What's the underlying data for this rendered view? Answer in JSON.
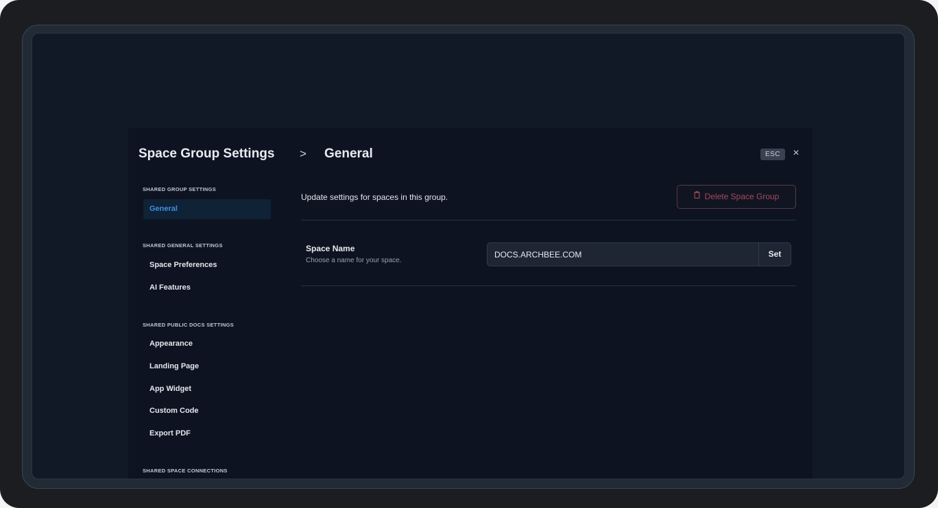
{
  "header": {
    "title": "Space Group Settings",
    "chevron": ">",
    "section": "General",
    "esc_label": "ESC",
    "close_symbol": "×"
  },
  "sidebar": {
    "groups": [
      {
        "heading": "SHARED GROUP SETTINGS",
        "items": [
          {
            "label": "General",
            "active": true
          }
        ]
      },
      {
        "heading": "SHARED GENERAL SETTINGS",
        "items": [
          {
            "label": "Space Preferences",
            "active": false
          },
          {
            "label": "AI Features",
            "active": false
          }
        ]
      },
      {
        "heading": "SHARED PUBLIC DOCS SETTINGS",
        "items": [
          {
            "label": "Appearance",
            "active": false
          },
          {
            "label": "Landing Page",
            "active": false
          },
          {
            "label": "App Widget",
            "active": false
          },
          {
            "label": "Custom Code",
            "active": false
          },
          {
            "label": "Export PDF",
            "active": false
          }
        ]
      },
      {
        "heading": "SHARED SPACE CONNECTIONS",
        "items": []
      }
    ]
  },
  "main": {
    "description": "Update settings for spaces in this group.",
    "delete_label": "Delete Space Group",
    "delete_icon": "trash-icon",
    "space_name": {
      "label": "Space Name",
      "help": "Choose a name for your space.",
      "value": "DOCS.ARCHBEE.COM",
      "set_label": "Set"
    }
  },
  "colors": {
    "accent": "#3d8fe0",
    "danger": "#a7485c",
    "modal_bg": "#0d1320",
    "screen_bg": "#111826"
  }
}
